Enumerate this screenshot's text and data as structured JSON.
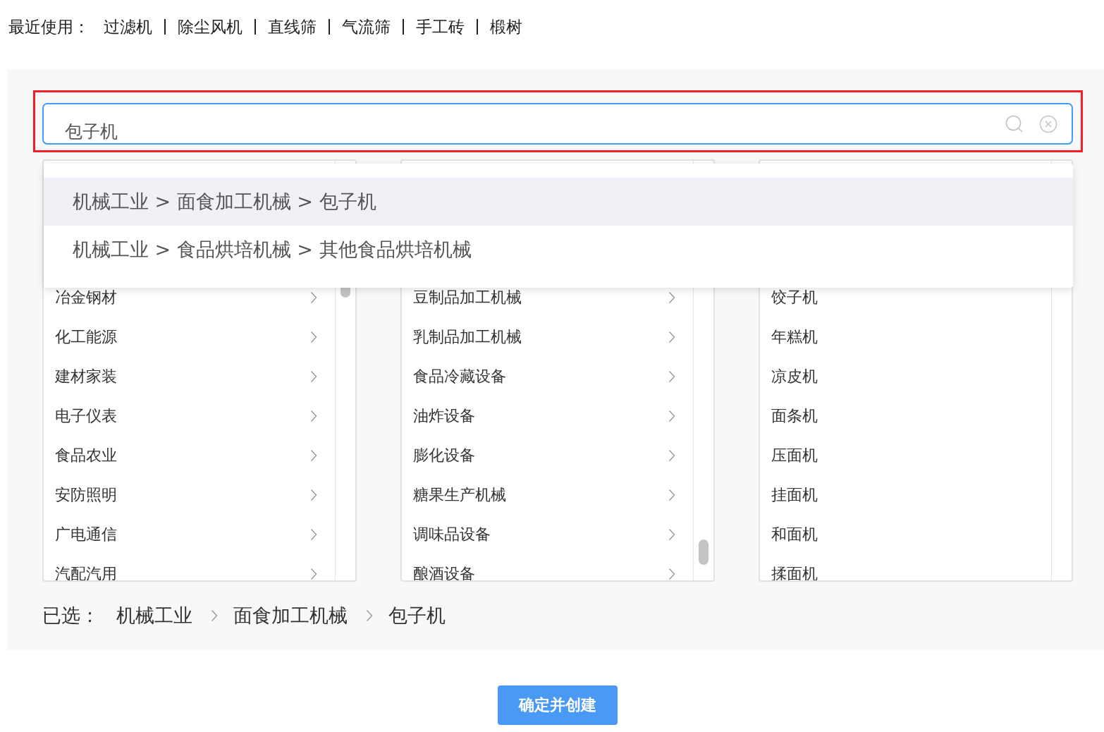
{
  "recent": {
    "label": "最近使用：",
    "items": [
      "过滤机",
      "除尘风机",
      "直线筛",
      "气流筛",
      "手工砖",
      "椴树"
    ]
  },
  "search": {
    "value": "包子机"
  },
  "suggestions": [
    {
      "text": "机械工业 > 面食加工机械 > 包子机",
      "selected": true
    },
    {
      "text": "机械工业 > 食品烘培机械 > 其他食品烘培机械",
      "selected": false
    }
  ],
  "columns": [
    {
      "items": [
        {
          "label": "冶金钢材",
          "has_children": true
        },
        {
          "label": "化工能源",
          "has_children": true
        },
        {
          "label": "建材家装",
          "has_children": true
        },
        {
          "label": "电子仪表",
          "has_children": true
        },
        {
          "label": "食品农业",
          "has_children": true
        },
        {
          "label": "安防照明",
          "has_children": true
        },
        {
          "label": "广电通信",
          "has_children": true
        },
        {
          "label": "汽配汽用",
          "has_children": true
        }
      ]
    },
    {
      "items": [
        {
          "label": "豆制品加工机械",
          "has_children": true
        },
        {
          "label": "乳制品加工机械",
          "has_children": true
        },
        {
          "label": "食品冷藏设备",
          "has_children": true
        },
        {
          "label": "油炸设备",
          "has_children": true
        },
        {
          "label": "膨化设备",
          "has_children": true
        },
        {
          "label": "糖果生产机械",
          "has_children": true
        },
        {
          "label": "调味品设备",
          "has_children": true
        },
        {
          "label": "酿酒设备",
          "has_children": true
        }
      ]
    },
    {
      "items": [
        {
          "label": "饺子机",
          "has_children": false
        },
        {
          "label": "年糕机",
          "has_children": false
        },
        {
          "label": "凉皮机",
          "has_children": false
        },
        {
          "label": "面条机",
          "has_children": false
        },
        {
          "label": "压面机",
          "has_children": false
        },
        {
          "label": "挂面机",
          "has_children": false
        },
        {
          "label": "和面机",
          "has_children": false
        },
        {
          "label": "揉面机",
          "has_children": false
        }
      ]
    }
  ],
  "selection": {
    "label": "已选：",
    "path": [
      "机械工业",
      "面食加工机械",
      "包子机"
    ]
  },
  "confirm_button": "确定并创建"
}
